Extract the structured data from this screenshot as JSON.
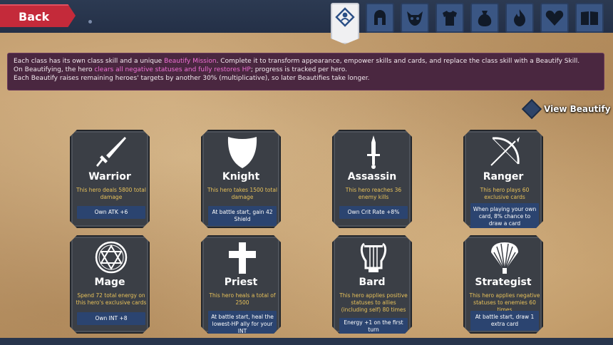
{
  "nav": {
    "back_label": "Back"
  },
  "tabs": [
    {
      "icon": "beautify-emblem-icon",
      "active": true
    },
    {
      "icon": "helmet-icon",
      "active": false
    },
    {
      "icon": "monster-face-icon",
      "active": false
    },
    {
      "icon": "armor-icon",
      "active": false
    },
    {
      "icon": "loot-bag-icon",
      "active": false
    },
    {
      "icon": "flame-icon",
      "active": false
    },
    {
      "icon": "heart-icon",
      "active": false
    },
    {
      "icon": "book-icon",
      "active": false
    }
  ],
  "banner": {
    "line1_a": "Each class has its own class skill and a unique ",
    "line1_hl": "Beautify Mission",
    "line1_b": ". Complete it to transform appearance, empower skills and cards, and replace the class skill with a Beautify Skill.",
    "line2_a": "On Beautifying, the hero ",
    "line2_hl": "clears all negative statuses and fully restores HP",
    "line2_b": "; progress is tracked per hero.",
    "line3": "Each Beautify raises remaining heroes' targets by another 30% (multiplicative), so later Beautifies take longer."
  },
  "view_beautify_label": "View Beautify",
  "classes": [
    {
      "name": "Warrior",
      "icon": "sword-icon",
      "mission": "This hero deals 5800 total damage",
      "bonus": "Own ATK +6"
    },
    {
      "name": "Knight",
      "icon": "shield-icon",
      "mission": "This hero takes 1500 total damage",
      "bonus": "At battle start, gain 42 Shield"
    },
    {
      "name": "Assassin",
      "icon": "dagger-icon",
      "mission": "This hero reaches 36 enemy kills",
      "bonus": "Own Crit Rate +8%"
    },
    {
      "name": "Ranger",
      "icon": "bow-icon",
      "mission": "This hero plays 60 exclusive cards",
      "bonus": "When playing your own card, 8% chance to draw a card"
    },
    {
      "name": "Mage",
      "icon": "hexagram-icon",
      "mission": "Spend 72 total energy on this hero's exclusive cards",
      "bonus": "Own INT +8"
    },
    {
      "name": "Priest",
      "icon": "cross-icon",
      "mission": "This hero heals a total of 2500",
      "bonus": "At battle start, heal the lowest-HP ally for your INT"
    },
    {
      "name": "Bard",
      "icon": "lyre-icon",
      "mission": "This hero applies positive statuses to allies (including self) 80 times",
      "bonus": "Energy +1 on the first turn"
    },
    {
      "name": "Strategist",
      "icon": "feather-fan-icon",
      "mission": "This hero applies negative statuses to enemies 60 times",
      "bonus": "At battle start, draw 1 extra card"
    }
  ],
  "colors": {
    "back_button": "#c42a3a",
    "tab": "#3a5684",
    "banner_bg": "#4a2740",
    "highlight": "#ee6fd4",
    "card_bg": "#3b3f46",
    "mission_text": "#e7c15a",
    "bonus_bg": "#2b4470"
  }
}
